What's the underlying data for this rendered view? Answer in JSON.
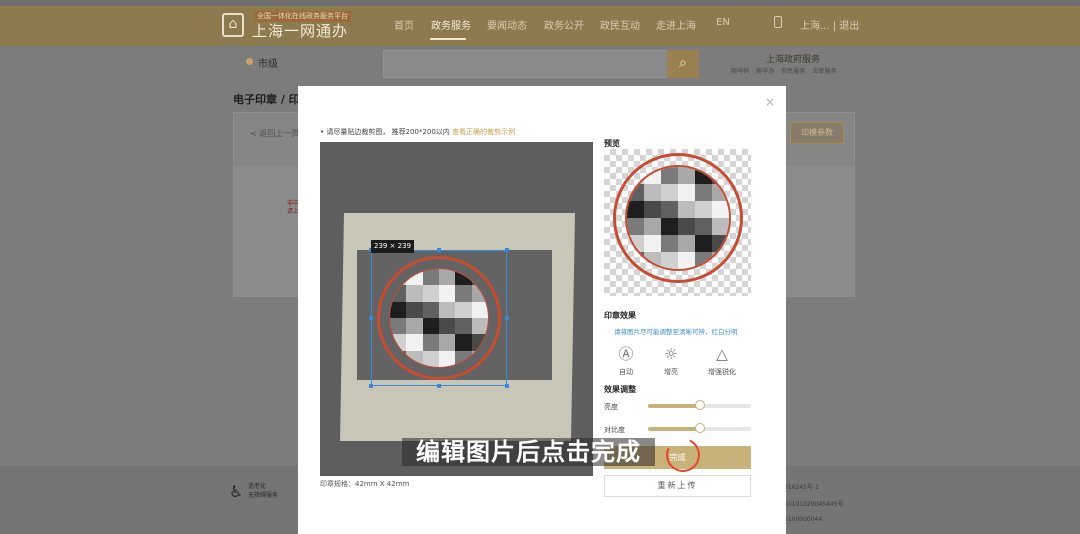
{
  "header": {
    "logo_tag": "全国一体化在线政务服务平台",
    "logo_title": "上海一网通办",
    "nav": [
      "首页",
      "政务服务",
      "要闻动态",
      "政务公开",
      "政民互动",
      "走进上海",
      "EN"
    ],
    "user_area": "上海... | 退出"
  },
  "background": {
    "location": "市级",
    "right_brand": "上海政府服务",
    "right_sub": "随申码 · 随申办 · 市民服务 · 法律服务",
    "breadcrumb": "电子印章 / 印",
    "prev_link": "< 返回上一页",
    "red_text_1": "非中",
    "red_text_2": "请上",
    "right_button": "印模参数"
  },
  "modal": {
    "hint_prefix": "• 请尽量贴边裁剪图， 推荐200*200以内",
    "hint_link": "查看正确的裁剪示例",
    "size_label": "239 × 239",
    "size_info": "印章规格：42mm X 42mm",
    "preview_title": "预览",
    "effect_title": "印章效果",
    "effect_hint": "请将图片尽可能调整至清晰可辨，红白分明",
    "effects": [
      {
        "icon": "Ⓐ",
        "label": "自动"
      },
      {
        "icon": "☼",
        "label": "增亮"
      },
      {
        "icon": "△",
        "label": "增强锐化"
      }
    ],
    "adjust_title": "效果调整",
    "sliders": [
      {
        "label": "亮度",
        "value": 0.5
      },
      {
        "label": "对比度",
        "value": 0.5
      }
    ],
    "done_button": "完成",
    "reupload_button": "重新上传",
    "close": "×"
  },
  "subtitle": "编辑图片后点击完成",
  "footer": {
    "accessibility_1": "适老化",
    "accessibility_2": "无障碍服务",
    "info": [
      "016245号-1",
      "10101020045445号",
      "5100000044"
    ]
  }
}
